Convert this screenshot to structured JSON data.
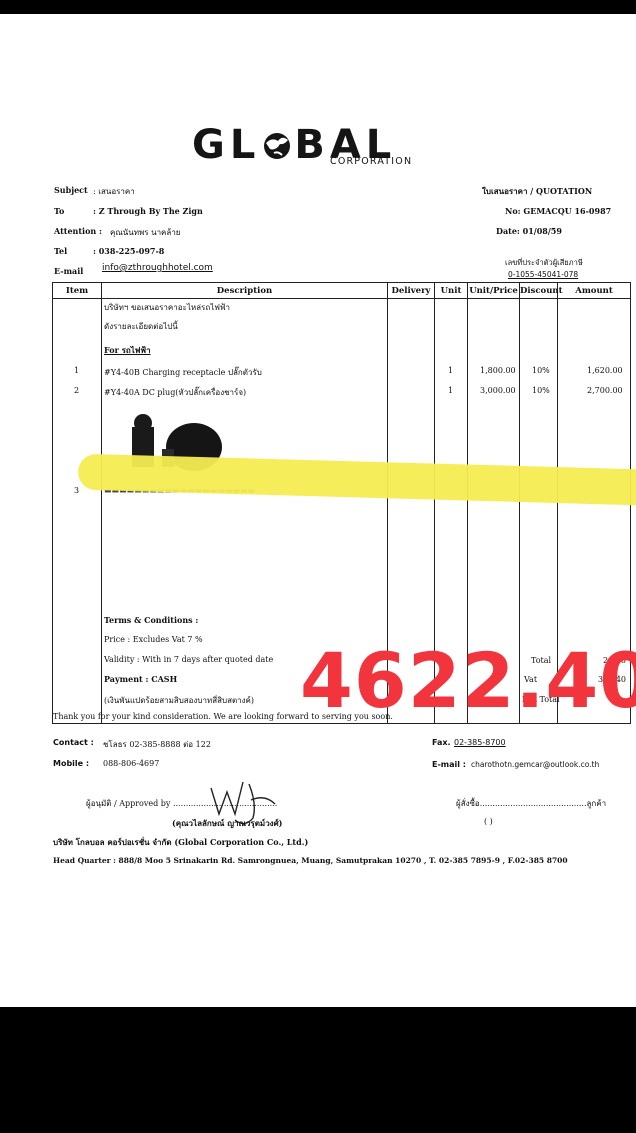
{
  "company": {
    "logo_text": "GL BAL",
    "logo_sub": "CORPORATION"
  },
  "header": {
    "subject_label": "Subject",
    "subject_value": ": เสนอราคา",
    "to_label": "To",
    "to_value": ": Z Through By The Zign",
    "attention_label": "Attention :",
    "attention_value": "คุณนันทพร นาคล้าย",
    "tel_label": "Tel",
    "tel_value": ": 038-225-097-8",
    "email_label": "E-mail",
    "email_value": "info@zthroughhotel.com",
    "doc_title": "ใบเสนอราคา / QUOTATION",
    "no_value": "No: GEMACQU 16-0987",
    "date_value": "Date: 01/08/59",
    "tax_label": "เลขที่ประจำตัวผู้เสียภาษี",
    "tax_value": "0-1055-45041-078"
  },
  "table": {
    "headers": [
      "Item",
      "Description",
      "Delivery",
      "Unit",
      "Unit/Price",
      "Discount",
      "Amount"
    ],
    "intro_line1": "บริษัทฯ ขอเสนอราคาอะไหล่รถไฟฟ้า",
    "intro_line2": "ดังรายละเอียดต่อไปนี้",
    "section": "For รถไฟฟ้า",
    "rows": [
      {
        "item": "1",
        "desc": "#Y4-40B  Charging receptacle  ปลั๊กตัวรับ",
        "unit": "1",
        "price": "1,800.00",
        "discount": "10%",
        "amount": "1,620.00"
      },
      {
        "item": "2",
        "desc": "#Y4-40A  DC plug(หัวปลั๊กเครื่องชาร์จ)",
        "unit": "1",
        "price": "3,000.00",
        "discount": "10%",
        "amount": "2,700.00"
      },
      {
        "item": "3",
        "desc": "",
        "unit": "",
        "price": "",
        "discount": "",
        "amount": ""
      }
    ],
    "terms_title": "Terms & Conditions :",
    "terms_price": "Price : Excludes Vat 7 %",
    "terms_validity": "Validity : With in 7 days after quoted date",
    "terms_payment": "Payment :  CASH",
    "amount_words": "(เงินพันแปดร้อยสามสิบสองบาทสี่สิบสตางค์)",
    "total_label": "Total",
    "vat_label": "Vat",
    "net_label": "Net  Total",
    "total_value": "20.00",
    "vat_value": "312.40"
  },
  "footer": {
    "thanks": "Thank you for your kind consideration. We are looking forward to serving you soon.",
    "contact_label": "Contact :",
    "contact_value": "ชโลธร 02-385-8888  ต่อ 122",
    "mobile_label": "Mobile :",
    "mobile_value": "088-806-4697",
    "fax_label": "Fax.",
    "fax_value": "02-385-8700",
    "email_label": "E-mail :",
    "email_value": "charothotn.gemcar@outlook.co.th",
    "approved": "ผู้อนุมัติ / Approved by .........................................",
    "approver_name": "(คุณวไลลักษณ์ ญาณวรุตม์วงศ์)",
    "orderer": "ผู้สั่งซื้อ..........................................ลูกค้า",
    "orderer_paren": "(                                        )",
    "company_name": "บริษัท โกลบอล คอร์ปอเรชั่น จำกัด (Global Corporation Co., Ltd.)",
    "hq": "Head Quarter : 888/8  Moo 5 Srinakarin Rd. Samrongnuea, Muang, Samutprakan 10270 , T. 02-385 7895-9 , F.02-385 8700"
  },
  "overlay": {
    "handwritten_total": "4622.40",
    "highlight_color": "#f6ec52",
    "total_color": "#f2353d"
  }
}
